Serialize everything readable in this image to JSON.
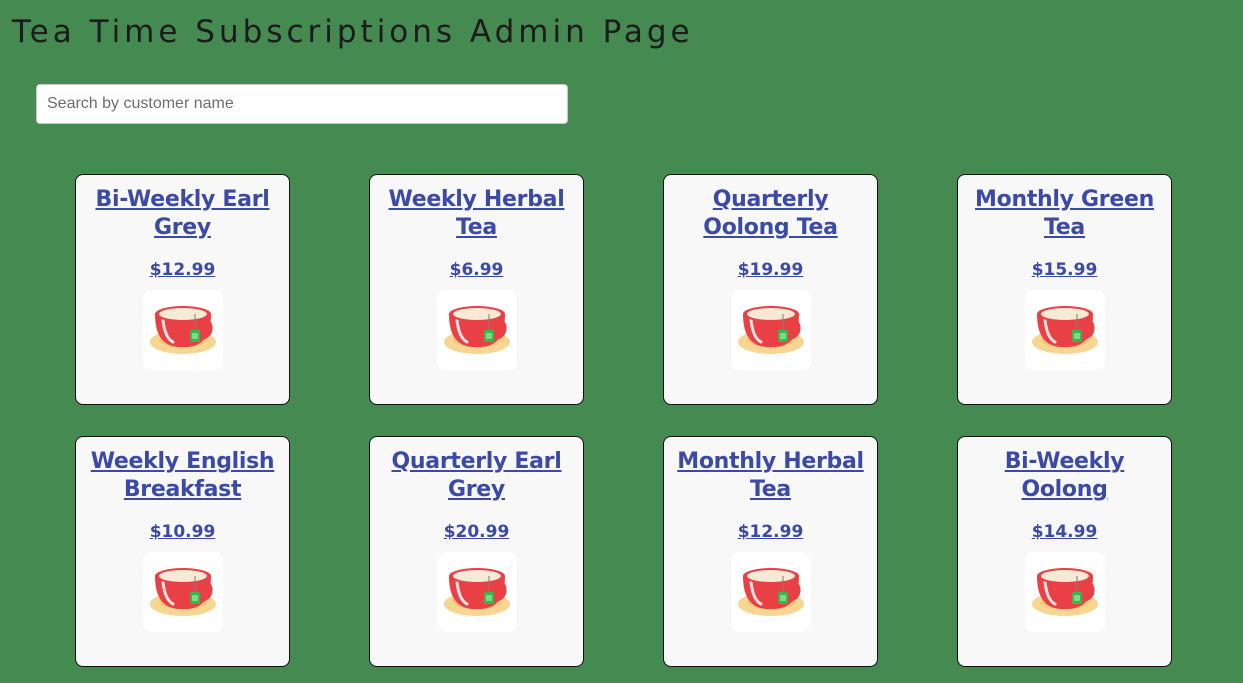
{
  "header": {
    "title": "Tea Time Subscriptions Admin Page"
  },
  "search": {
    "placeholder": "Search by customer name",
    "value": ""
  },
  "subscriptions": [
    {
      "title": "Bi-Weekly Earl Grey",
      "price": "$12.99",
      "image_icon": "teacup-icon"
    },
    {
      "title": "Weekly Herbal Tea",
      "price": "$6.99",
      "image_icon": "teacup-icon"
    },
    {
      "title": "Quarterly Oolong Tea",
      "price": "$19.99",
      "image_icon": "teacup-icon"
    },
    {
      "title": "Monthly Green Tea",
      "price": "$15.99",
      "image_icon": "teacup-icon"
    },
    {
      "title": "Weekly English Breakfast",
      "price": "$10.99",
      "image_icon": "teacup-icon"
    },
    {
      "title": "Quarterly Earl Grey",
      "price": "$20.99",
      "image_icon": "teacup-icon"
    },
    {
      "title": "Monthly Herbal Tea",
      "price": "$12.99",
      "image_icon": "teacup-icon"
    },
    {
      "title": "Bi-Weekly Oolong",
      "price": "$14.99",
      "image_icon": "teacup-icon"
    }
  ],
  "colors": {
    "background": "#448a51",
    "link": "#3b4aa6",
    "card_background": "#f8f8f8",
    "cup_red": "#e94046",
    "saucer": "#f7d592",
    "tea_bag_tag": "#3cb54a"
  }
}
